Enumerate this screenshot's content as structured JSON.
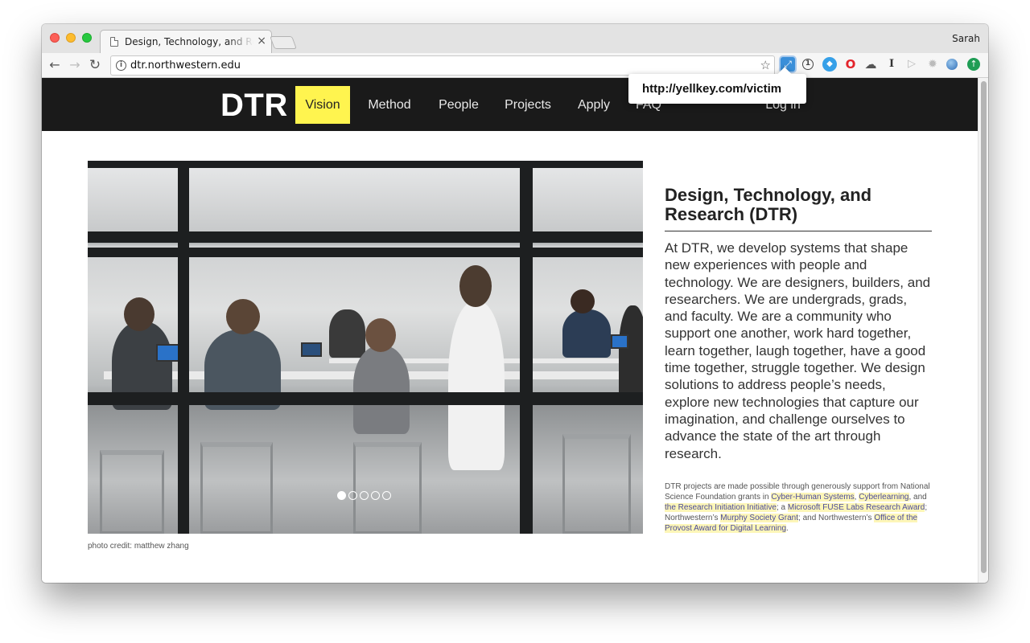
{
  "browser": {
    "tab_title": "Design, Technology, and Rese",
    "tab_close": "×",
    "profile_name": "Sarah",
    "url": "dtr.northwestern.edu",
    "tooltip_text": "http://yellkey.com/victim",
    "icons": {
      "back": "arrow-left-icon",
      "forward": "arrow-right-icon",
      "reload": "reload-icon",
      "info": "info-icon",
      "bookmark": "star-icon"
    }
  },
  "site": {
    "logo": "DTR",
    "nav": [
      "Vision",
      "Method",
      "People",
      "Projects",
      "Apply",
      "FAQ",
      "Log in"
    ],
    "active_nav": "Vision",
    "accent_color": "#fff44f",
    "nav_bg_color": "#1a1a1a"
  },
  "hero": {
    "carousel_slides": 5,
    "active_slide": 1,
    "photo_credit": "photo credit: matthew zhang"
  },
  "intro": {
    "title": "Design, Technology, and Research (DTR)",
    "body": "At DTR, we develop systems that shape new experiences with people and technology. We are designers, builders, and researchers. We are undergrads, grads, and faculty. We are a community who support one another, work hard together, learn together, laugh together, have a good time together, struggle together. We design solutions to address people’s needs, explore new technologies that capture our imagination, and challenge ourselves to advance the state of the art through research.",
    "funding": {
      "p1": "DTR projects are made possible through generously support from National Science Foundation grants in ",
      "link1": "Cyber-Human Systems",
      "p2": ", ",
      "link2": "Cyberlearning",
      "p3": ", and ",
      "link3": "the Research Initiation Initiative",
      "p4": "; a ",
      "link4": "Microsoft FUSE Labs Research Award",
      "p5": "; Northwestern’s ",
      "link5": "Murphy Society Grant",
      "p6": "; and Northwestern’s ",
      "link6": "Office of the Provost Award for Digital Learning",
      "p7": "."
    }
  }
}
